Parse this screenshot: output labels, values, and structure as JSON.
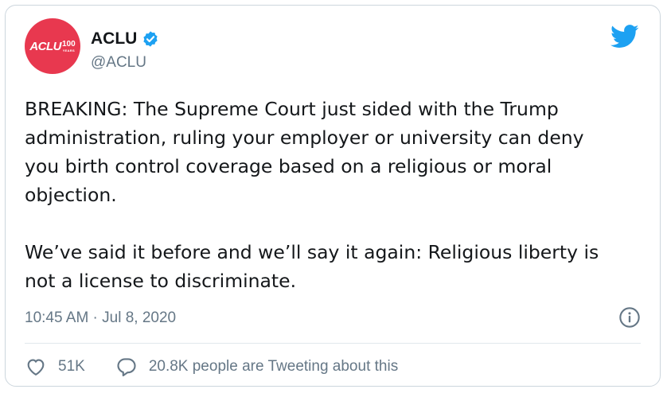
{
  "author": {
    "avatar_text": "ACLU",
    "avatar_badge_number": "100",
    "avatar_badge_caption": "YEARS",
    "display_name": "ACLU",
    "handle": "@ACLU",
    "verified": true
  },
  "tweet": {
    "text": "BREAKING: The Supreme Court just sided with the Trump\nadministration, ruling your employer or university can deny\nyou birth control coverage based on a religious or moral\nobjection.\n\nWe’ve said it before and we’ll say it again: Religious liberty is\nnot a license to discriminate.",
    "timestamp": "10:45 AM · Jul 8, 2020"
  },
  "actions": {
    "likes": "51K",
    "conversation": "20.8K people are Tweeting about this"
  },
  "icons": {
    "brand": "twitter-bird-icon",
    "verified": "verified-badge-icon",
    "info": "info-icon",
    "like": "heart-icon",
    "reply": "speech-bubble-icon"
  },
  "colors": {
    "accent": "#1da1f2",
    "avatar_bg": "#e8384f",
    "text": "#14171a",
    "muted": "#657786",
    "border": "#ccd6dd"
  }
}
